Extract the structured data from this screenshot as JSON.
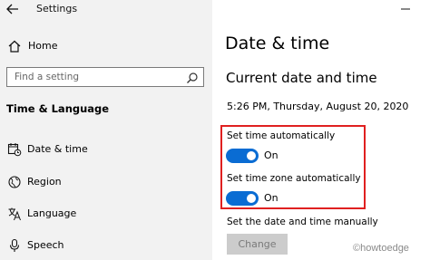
{
  "window": {
    "title": "Settings"
  },
  "sidebar": {
    "home_label": "Home",
    "search_placeholder": "Find a setting",
    "section_title": "Time & Language",
    "items": [
      {
        "label": "Date & time",
        "icon": "date-time-icon"
      },
      {
        "label": "Region",
        "icon": "globe-icon"
      },
      {
        "label": "Language",
        "icon": "language-icon"
      },
      {
        "label": "Speech",
        "icon": "microphone-icon"
      }
    ]
  },
  "main": {
    "page_title": "Date & time",
    "section_title": "Current date and time",
    "current_datetime": "5:26 PM, Thursday, August 20, 2020",
    "set_time_auto_label": "Set time automatically",
    "set_time_auto_state": "On",
    "set_timezone_auto_label": "Set time zone automatically",
    "set_timezone_auto_state": "On",
    "manual_label": "Set the date and time manually",
    "change_button": "Change"
  },
  "watermark": "©howtoedge",
  "colors": {
    "accent": "#0a6cd3",
    "highlight_border": "#e02020",
    "sidebar_bg": "#f2f2f2"
  }
}
